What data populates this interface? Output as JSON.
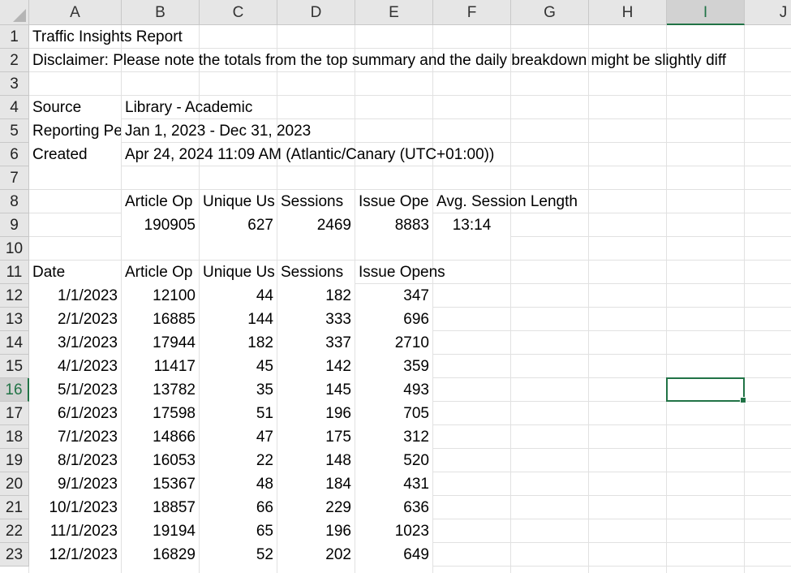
{
  "columns": [
    "A",
    "B",
    "C",
    "D",
    "E",
    "F",
    "G",
    "H",
    "I",
    "J"
  ],
  "rows": [
    "1",
    "2",
    "3",
    "4",
    "5",
    "6",
    "7",
    "8",
    "9",
    "10",
    "11",
    "12",
    "13",
    "14",
    "15",
    "16",
    "17",
    "18",
    "19",
    "20",
    "21",
    "22",
    "23"
  ],
  "selected": {
    "col": "I",
    "row": "16"
  },
  "report": {
    "title": "Traffic Insights Report",
    "disclaimer": "Disclaimer: Please note the totals from the top summary and the daily breakdown might be slightly diff",
    "source_label": "Source",
    "source_value": "Library - Academic",
    "period_label": "Reporting Pe",
    "period_value": "Jan 1, 2023 - Dec 31, 2023",
    "created_label": "Created",
    "created_value": "Apr 24, 2024 11:09 AM (Atlantic/Canary (UTC+01:00))"
  },
  "summary": {
    "headers": [
      "Article Op",
      "Unique Us",
      "Sessions",
      "Issue Ope",
      "Avg. Session Length"
    ],
    "values": [
      "190905",
      "627",
      "2469",
      "8883",
      "13:14"
    ]
  },
  "breakdown": {
    "headers": [
      "Date",
      "Article Op",
      "Unique Us",
      "Sessions",
      "Issue Opens"
    ],
    "rows": [
      [
        "1/1/2023",
        "12100",
        "44",
        "182",
        "347"
      ],
      [
        "2/1/2023",
        "16885",
        "144",
        "333",
        "696"
      ],
      [
        "3/1/2023",
        "17944",
        "182",
        "337",
        "2710"
      ],
      [
        "4/1/2023",
        "11417",
        "45",
        "142",
        "359"
      ],
      [
        "5/1/2023",
        "13782",
        "35",
        "145",
        "493"
      ],
      [
        "6/1/2023",
        "17598",
        "51",
        "196",
        "705"
      ],
      [
        "7/1/2023",
        "14866",
        "47",
        "175",
        "312"
      ],
      [
        "8/1/2023",
        "16053",
        "22",
        "148",
        "520"
      ],
      [
        "9/1/2023",
        "15367",
        "48",
        "184",
        "431"
      ],
      [
        "10/1/2023",
        "18857",
        "66",
        "229",
        "636"
      ],
      [
        "11/1/2023",
        "19194",
        "65",
        "196",
        "1023"
      ],
      [
        "12/1/2023",
        "16829",
        "52",
        "202",
        "649"
      ]
    ]
  },
  "colors": {
    "accent": "#217346",
    "header_bg": "#e6e6e6",
    "gridline": "#e1e1e1"
  }
}
